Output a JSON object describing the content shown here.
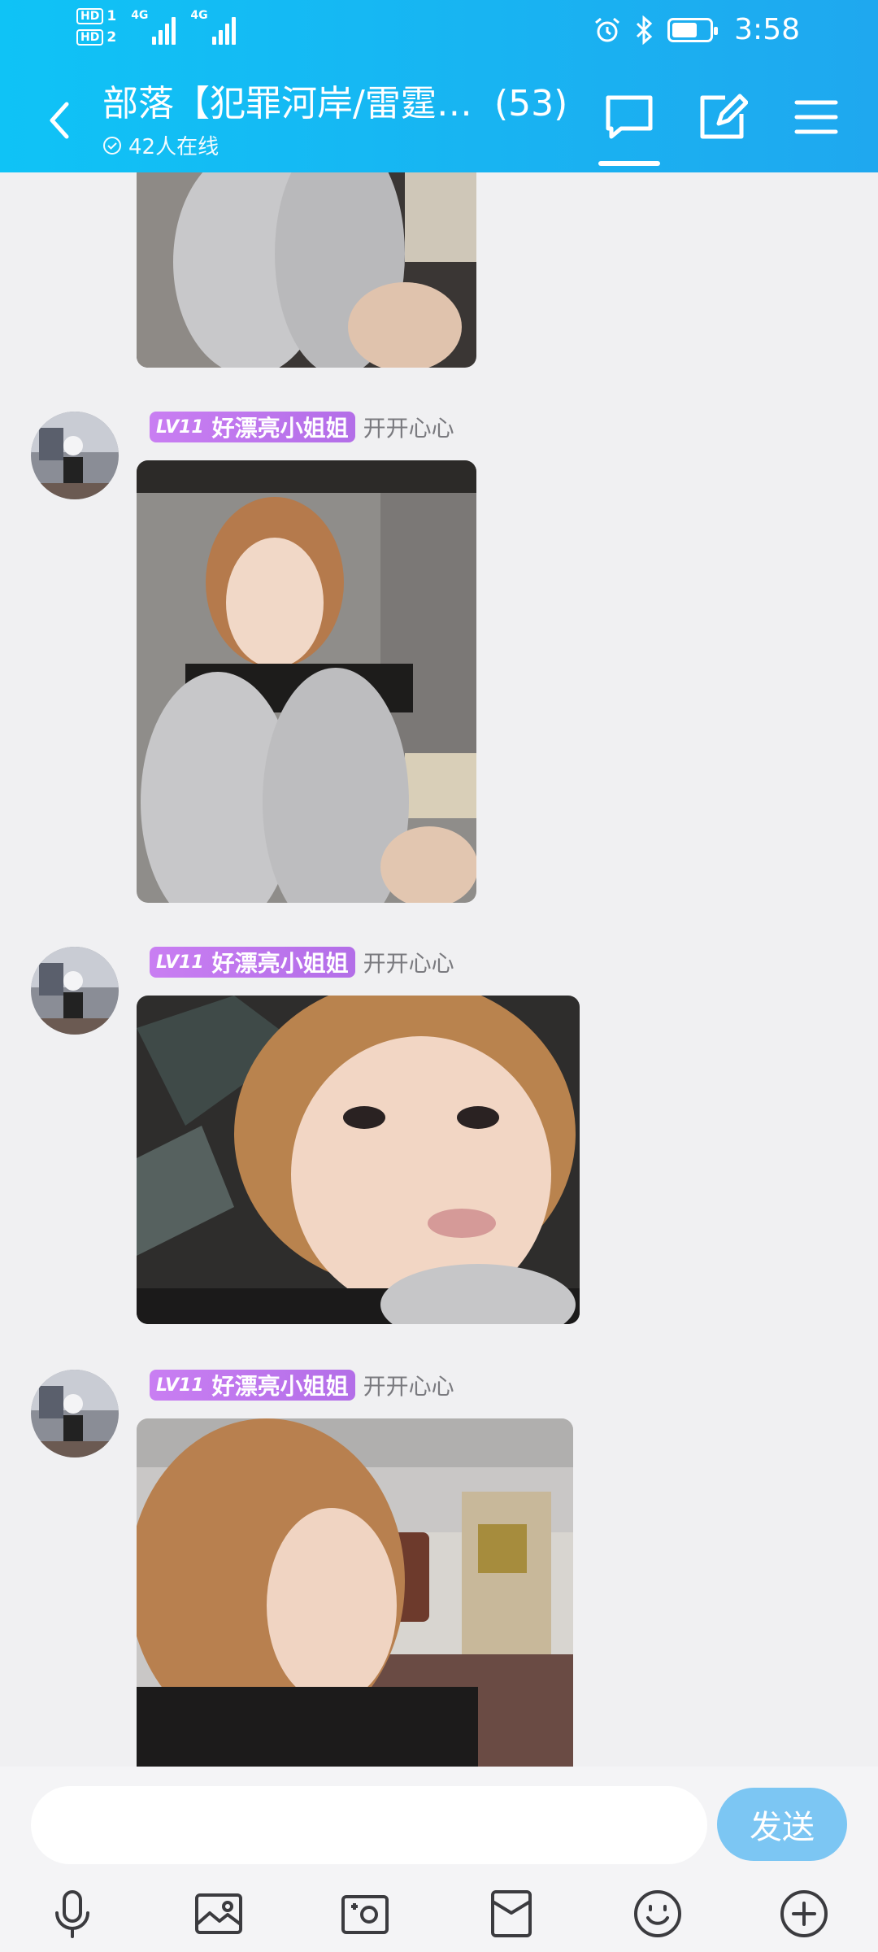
{
  "status_bar": {
    "time": "3:58",
    "sim1": "HD",
    "sim1_num": "1",
    "sim2": "HD",
    "sim2_num": "2",
    "network1": "4G",
    "network2": "4G",
    "icons": [
      "alarm-icon",
      "bluetooth-icon",
      "battery-icon"
    ]
  },
  "header": {
    "group_name": "部落【犯罪河岸/雷霆…",
    "member_count": "(53)",
    "online_text": "42人在线",
    "icons": [
      "back-icon",
      "chat-icon",
      "edit-icon",
      "menu-icon"
    ],
    "accent": "#18b4f2"
  },
  "messages": [
    {
      "level": "LV11",
      "sender": "好漂亮小姐姐",
      "text": "开开心心",
      "content": "photo"
    },
    {
      "level": "LV11",
      "sender": "好漂亮小姐姐",
      "text": "开开心心",
      "content": "photo"
    },
    {
      "level": "LV11",
      "sender": "好漂亮小姐姐",
      "text": "开开心心",
      "content": "photo"
    }
  ],
  "input": {
    "placeholder": "",
    "send_label": "发送",
    "tools": [
      "microphone-icon",
      "image-icon",
      "camera-icon",
      "red-packet-icon",
      "emoji-icon",
      "plus-icon"
    ]
  }
}
